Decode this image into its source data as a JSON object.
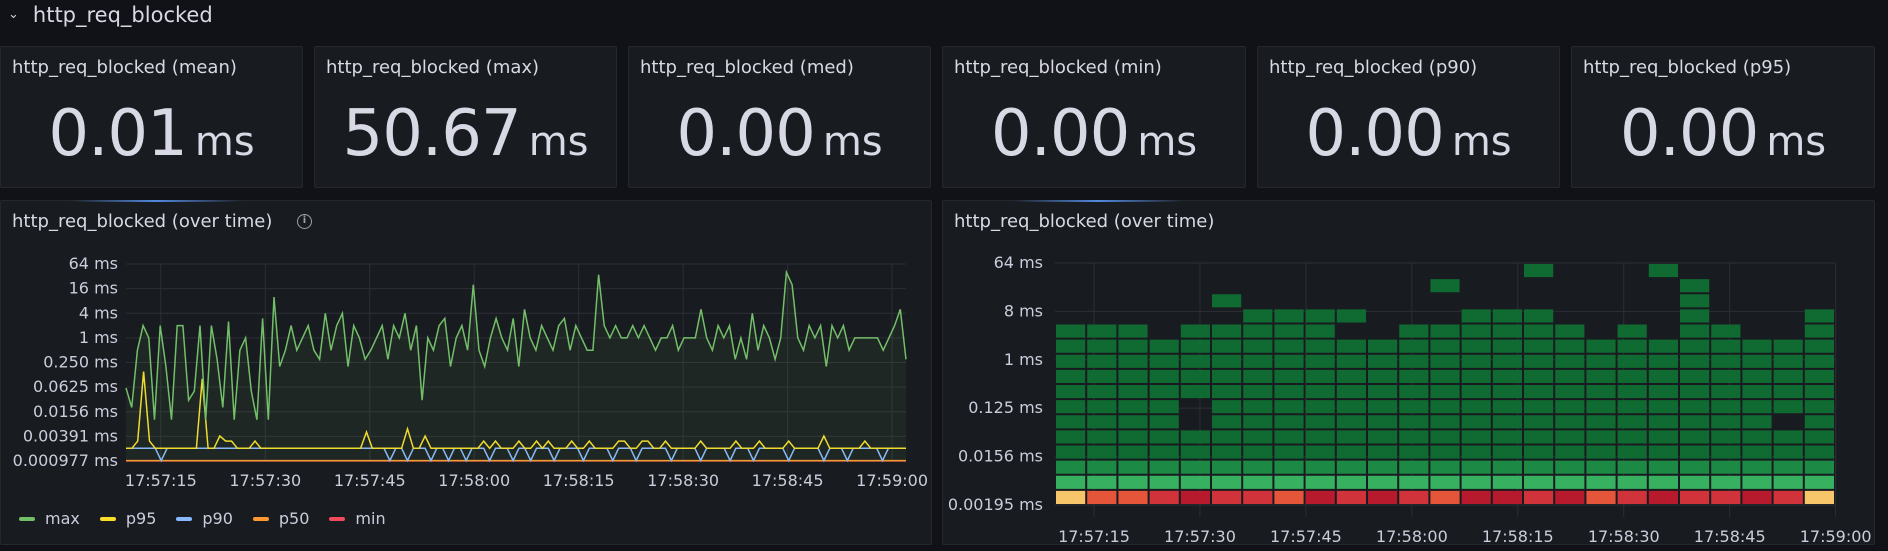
{
  "row": {
    "title": "http_req_blocked"
  },
  "stats": [
    {
      "title": "http_req_blocked (mean)",
      "value": "0.01",
      "unit": "ms"
    },
    {
      "title": "http_req_blocked (max)",
      "value": "50.67",
      "unit": "ms"
    },
    {
      "title": "http_req_blocked (med)",
      "value": "0.00",
      "unit": "ms"
    },
    {
      "title": "http_req_blocked (min)",
      "value": "0.00",
      "unit": "ms"
    },
    {
      "title": "http_req_blocked (p90)",
      "value": "0.00",
      "unit": "ms"
    },
    {
      "title": "http_req_blocked (p95)",
      "value": "0.00",
      "unit": "ms"
    }
  ],
  "timeseries": {
    "title": "http_req_blocked (over time)",
    "legend": [
      {
        "name": "max",
        "color": "#73bf69"
      },
      {
        "name": "p95",
        "color": "#fade2a"
      },
      {
        "name": "p90",
        "color": "#8ab8ff"
      },
      {
        "name": "p50",
        "color": "#ff9830"
      },
      {
        "name": "min",
        "color": "#f2495c"
      }
    ]
  },
  "heatmap": {
    "title": "http_req_blocked (over time)"
  },
  "chart_data": [
    {
      "type": "line",
      "yscale": "log2",
      "yunit": "ms",
      "y_ticks": [
        "64 ms",
        "16 ms",
        "4 ms",
        "1 ms",
        "0.250 ms",
        "0.0625 ms",
        "0.0156 ms",
        "0.00391 ms",
        "0.000977 ms"
      ],
      "y_tick_values": [
        64,
        16,
        4,
        1,
        0.25,
        0.0625,
        0.0156,
        0.00391,
        0.000977
      ],
      "x_ticks": [
        "17:57:15",
        "17:57:30",
        "17:57:45",
        "17:58:00",
        "17:58:15",
        "17:58:30",
        "17:58:45",
        "17:59:00"
      ],
      "x_range": [
        "17:57:10",
        "17:59:02"
      ],
      "grid": true,
      "legend_position": "bottom-left",
      "series": [
        {
          "name": "max",
          "values": [
            0.06,
            0.02,
            0.5,
            2,
            1,
            0.01,
            2,
            0.2,
            0.01,
            2,
            2,
            0.03,
            0.05,
            2,
            0.01,
            2,
            0.3,
            0.02,
            2.5,
            0.01,
            0.5,
            1,
            0.05,
            0.01,
            3,
            0.01,
            10,
            0.2,
            0.5,
            2,
            0.5,
            1,
            2,
            0.5,
            0.3,
            4,
            0.5,
            2,
            4,
            0.2,
            2,
            1,
            0.3,
            0.5,
            1,
            2,
            0.3,
            2,
            1,
            4,
            0.5,
            2,
            0.03,
            1,
            0.5,
            2,
            3,
            0.2,
            1,
            2,
            0.5,
            20,
            0.5,
            0.2,
            1,
            3,
            1,
            0.5,
            3,
            0.2,
            5,
            1,
            0.5,
            2,
            1,
            0.5,
            2,
            3,
            0.5,
            2,
            1,
            0.5,
            0.5,
            35,
            2,
            1,
            2,
            1,
            1,
            2,
            1,
            2,
            1,
            0.5,
            1,
            1,
            2,
            0.5,
            1,
            1,
            1,
            5,
            1,
            0.5,
            2,
            1,
            2,
            0.3,
            1,
            0.3,
            4,
            0.5,
            2,
            1,
            0.3,
            1,
            40,
            20,
            1,
            0.5,
            2,
            1,
            2,
            0.2,
            2,
            1,
            2,
            0.5,
            1,
            1,
            1,
            1,
            1,
            0.5,
            1,
            2,
            5,
            0.3
          ]
        },
        {
          "name": "p95",
          "values": [
            0.002,
            0.002,
            0.003,
            0.15,
            0.003,
            0.002,
            0.002,
            0.002,
            0.002,
            0.002,
            0.002,
            0.002,
            0.002,
            0.1,
            0.002,
            0.002,
            0.004,
            0.003,
            0.003,
            0.002,
            0.002,
            0.002,
            0.003,
            0.002,
            0.002,
            0.002,
            0.002,
            0.002,
            0.002,
            0.002,
            0.002,
            0.002,
            0.002,
            0.002,
            0.002,
            0.002,
            0.002,
            0.002,
            0.002,
            0.002,
            0.002,
            0.005,
            0.002,
            0.002,
            0.002,
            0.002,
            0.002,
            0.002,
            0.006,
            0.002,
            0.002,
            0.004,
            0.002,
            0.002,
            0.002,
            0.002,
            0.002,
            0.002,
            0.002,
            0.002,
            0.002,
            0.003,
            0.002,
            0.003,
            0.002,
            0.002,
            0.002,
            0.003,
            0.002,
            0.002,
            0.003,
            0.002,
            0.003,
            0.002,
            0.002,
            0.002,
            0.003,
            0.002,
            0.002,
            0.003,
            0.002,
            0.002,
            0.002,
            0.002,
            0.003,
            0.003,
            0.002,
            0.002,
            0.003,
            0.003,
            0.002,
            0.002,
            0.003,
            0.002,
            0.002,
            0.002,
            0.002,
            0.002,
            0.003,
            0.002,
            0.002,
            0.002,
            0.002,
            0.002,
            0.003,
            0.002,
            0.002,
            0.002,
            0.003,
            0.002,
            0.002,
            0.002,
            0.002,
            0.003,
            0.002,
            0.002,
            0.002,
            0.002,
            0.002,
            0.004,
            0.002,
            0.002,
            0.002,
            0.002,
            0.002,
            0.002,
            0.003,
            0.002,
            0.002,
            0.002,
            0.002,
            0.002,
            0.002,
            0.002
          ]
        },
        {
          "name": "p90",
          "values": [
            0.002,
            0.002,
            0.002,
            0.002,
            0.002,
            0.002,
            0.001,
            0.002,
            0.002,
            0.002,
            0.002,
            0.002,
            0.002,
            0.002,
            0.002,
            0.002,
            0.002,
            0.002,
            0.002,
            0.002,
            0.002,
            0.002,
            0.002,
            0.002,
            0.002,
            0.002,
            0.002,
            0.002,
            0.002,
            0.002,
            0.002,
            0.002,
            0.002,
            0.002,
            0.002,
            0.002,
            0.002,
            0.002,
            0.002,
            0.002,
            0.002,
            0.002,
            0.002,
            0.002,
            0.002,
            0.001,
            0.002,
            0.002,
            0.001,
            0.002,
            0.002,
            0.002,
            0.001,
            0.002,
            0.002,
            0.001,
            0.002,
            0.002,
            0.001,
            0.002,
            0.002,
            0.002,
            0.001,
            0.002,
            0.002,
            0.002,
            0.001,
            0.002,
            0.002,
            0.001,
            0.002,
            0.002,
            0.002,
            0.001,
            0.002,
            0.002,
            0.002,
            0.002,
            0.001,
            0.002,
            0.002,
            0.002,
            0.002,
            0.001,
            0.002,
            0.002,
            0.002,
            0.001,
            0.002,
            0.002,
            0.002,
            0.002,
            0.002,
            0.001,
            0.002,
            0.002,
            0.002,
            0.002,
            0.001,
            0.002,
            0.002,
            0.002,
            0.002,
            0.001,
            0.002,
            0.002,
            0.002,
            0.001,
            0.002,
            0.002,
            0.002,
            0.002,
            0.002,
            0.001,
            0.002,
            0.002,
            0.002,
            0.002,
            0.002,
            0.001,
            0.002,
            0.002,
            0.002,
            0.001,
            0.002,
            0.002,
            0.002,
            0.002,
            0.002,
            0.001,
            0.002,
            0.002,
            0.002,
            0.002
          ]
        },
        {
          "name": "p50",
          "values": [
            0.001,
            0.001,
            0.001,
            0.001,
            0.001,
            0.001,
            0.001,
            0.001,
            0.001,
            0.001
          ]
        },
        {
          "name": "min",
          "values": [
            0.00098,
            0.00098,
            0.00098,
            0.00098,
            0.00098,
            0.00098,
            0.00098,
            0.00098,
            0.00098,
            0.00098
          ]
        }
      ]
    },
    {
      "type": "heatmap",
      "yscale": "log2",
      "yunit": "ms",
      "y_ticks": [
        "64 ms",
        "8 ms",
        "1 ms",
        "0.125 ms",
        "0.0156 ms",
        "0.00195 ms"
      ],
      "y_tick_values": [
        64,
        8,
        1,
        0.125,
        0.0156,
        0.00195
      ],
      "x_ticks": [
        "17:57:15",
        "17:57:30",
        "17:57:45",
        "17:58:00",
        "17:58:15",
        "17:58:30",
        "17:58:45",
        "17:59:00"
      ],
      "buckets_per_column": 16,
      "grid": true,
      "columns": [
        {
          "top": 11,
          "low": [
            1,
            8,
            7,
            6
          ]
        },
        {
          "top": 11,
          "low": [
            1,
            8,
            7,
            6
          ]
        },
        {
          "top": 11,
          "low": [
            1,
            8,
            7,
            6
          ]
        },
        {
          "top": 10,
          "low": [
            1,
            8,
            7,
            5
          ]
        },
        {
          "top": 11,
          "low": [
            1,
            8,
            6,
            5
          ],
          "gaps": [
            5,
            6
          ]
        },
        {
          "top": 13,
          "low": [
            1,
            8,
            7,
            5
          ],
          "gaps": [
            12
          ]
        },
        {
          "top": 12,
          "low": [
            1,
            8,
            7,
            5
          ]
        },
        {
          "top": 12,
          "low": [
            1,
            8,
            7,
            6
          ]
        },
        {
          "top": 12,
          "low": [
            1,
            8,
            7,
            5
          ]
        },
        {
          "top": 12,
          "low": [
            1,
            8,
            7,
            5
          ],
          "gaps": [
            11
          ]
        },
        {
          "top": 10,
          "low": [
            1,
            8,
            7,
            5
          ]
        },
        {
          "top": 11,
          "low": [
            1,
            8,
            7,
            5
          ]
        },
        {
          "top": 14,
          "low": [
            1,
            8,
            7,
            5
          ],
          "gaps": [
            12,
            13
          ]
        },
        {
          "top": 12,
          "low": [
            1,
            8,
            7,
            6
          ]
        },
        {
          "top": 12,
          "low": [
            1,
            8,
            7,
            5
          ]
        },
        {
          "top": 15,
          "low": [
            1,
            8,
            7,
            5
          ],
          "gaps": [
            13,
            14
          ]
        },
        {
          "top": 11,
          "low": [
            1,
            8,
            7,
            5
          ]
        },
        {
          "top": 10,
          "low": [
            1,
            8,
            7,
            6
          ]
        },
        {
          "top": 11,
          "low": [
            1,
            8,
            7,
            5
          ]
        },
        {
          "top": 15,
          "low": [
            1,
            8,
            7,
            5
          ],
          "gaps": [
            11,
            12,
            13,
            14
          ]
        },
        {
          "top": 14,
          "low": [
            1,
            8,
            7,
            5
          ]
        },
        {
          "top": 11,
          "low": [
            1,
            8,
            7,
            5
          ]
        },
        {
          "top": 10,
          "low": [
            1,
            8,
            7,
            5
          ]
        },
        {
          "top": 10,
          "low": [
            1,
            8,
            7,
            5
          ],
          "gaps": [
            5
          ]
        },
        {
          "top": 12,
          "low": [
            1,
            8,
            7,
            6
          ]
        }
      ],
      "bottom_row_levels": [
        9,
        7,
        7,
        6,
        5,
        6,
        6,
        7,
        5,
        6,
        5,
        6,
        7,
        5,
        5,
        6,
        5,
        7,
        6,
        5,
        6,
        6,
        5,
        6,
        9
      ]
    }
  ]
}
